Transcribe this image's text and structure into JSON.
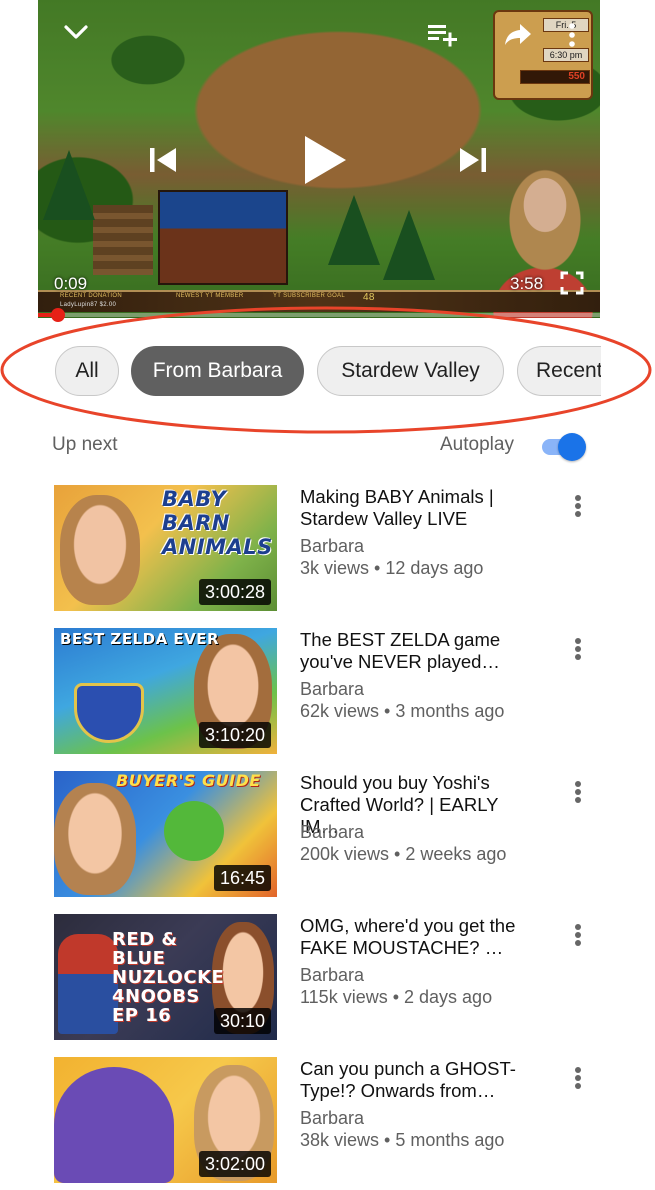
{
  "player": {
    "current_time": "0:09",
    "duration": "3:58",
    "progress_fraction": 0.038,
    "overlay": {
      "clock_day": "Fri. 5",
      "clock_time": "6:30 pm",
      "gold": "550",
      "hud_left": "RECENT DONATION",
      "hud_left_sub": "LadyLupin87 $2.00",
      "hud_mid": "NEWEST YT MEMBER",
      "hud_right": "YT SUBSCRIBER GOAL",
      "hud_goal": "48"
    }
  },
  "chips": [
    {
      "label": "All",
      "selected": false
    },
    {
      "label": "From Barbara",
      "selected": true
    },
    {
      "label": "Stardew Valley",
      "selected": false
    },
    {
      "label": "Recent",
      "selected": false
    }
  ],
  "up_next": {
    "label": "Up next",
    "autoplay_label": "Autoplay",
    "autoplay_on": true
  },
  "videos": [
    {
      "title": "Making BABY Animals | Stardew Valley LIVE",
      "channel": "Barbara",
      "meta": "3k views  • 12 days ago",
      "duration": "3:00:28",
      "thumb_text": "BABY BARN ANIMALS"
    },
    {
      "title": "The BEST ZELDA game you've NEVER played…",
      "channel": "Barbara",
      "meta": "62k views • 3 months ago",
      "duration": "3:10:20",
      "thumb_text": "BEST ZELDA EVER"
    },
    {
      "title": "Should you buy Yoshi's Crafted World? | EARLY IM…",
      "channel": "Barbara",
      "meta": "200k views • 2 weeks ago",
      "duration": "16:45",
      "thumb_text": "BUYER'S GUIDE"
    },
    {
      "title": "OMG, where'd you get the FAKE MOUSTACHE? …",
      "channel": "Barbara",
      "meta": "115k views • 2 days ago",
      "duration": "30:10",
      "thumb_text": "RED & BLUE NUZLOCKE 4NOOBS EP 16"
    },
    {
      "title": "Can you punch a GHOST-Type!? Onwards from…",
      "channel": "Barbara",
      "meta": "38k views • 5 months ago",
      "duration": "3:02:00",
      "thumb_text": ""
    }
  ],
  "colors": {
    "accent_red": "#e62117",
    "annotation_red": "#e8442a",
    "toggle_blue": "#1a73e8",
    "chip_selected": "#606060"
  },
  "icons": [
    "chevron-down-icon",
    "add-to-queue-icon",
    "share-icon",
    "more-vert-icon",
    "skip-previous-icon",
    "play-icon",
    "skip-next-icon",
    "fullscreen-icon"
  ]
}
